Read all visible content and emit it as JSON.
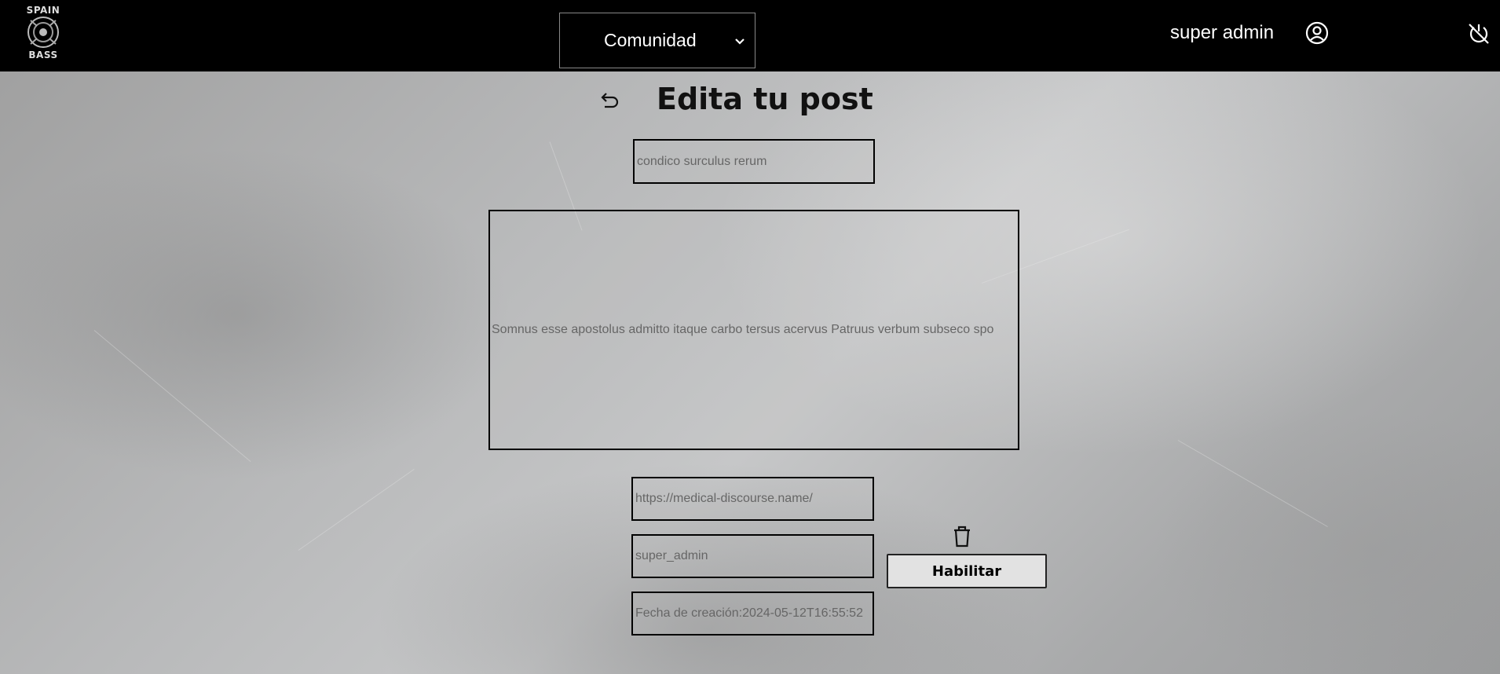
{
  "header": {
    "logo": {
      "top_text": "SPAIN",
      "bottom_text": "BASS"
    },
    "section_select": {
      "selected": "Comunidad",
      "icon": "chevron-down-icon"
    },
    "user": {
      "name": "super admin",
      "icon": "user-circle-icon"
    },
    "logout_icon": "power-off-icon"
  },
  "main": {
    "back_icon": "undo-arrow-icon",
    "title": "Edita tu post",
    "fields": {
      "title_value": "condico surculus rerum",
      "content_value": "Somnus esse apostolus admitto itaque carbo tersus acervus Patruus verbum subseco spo",
      "url_value": "https://medical-discourse.name/",
      "author_value": "super_admin",
      "date_value": "Fecha de creación:2024-05-12T16:55:52"
    },
    "delete_icon": "trash-icon",
    "enable_button": "Habilitar"
  },
  "colors": {
    "navbar": "#000000",
    "background": "#b3b4b5",
    "button_bg": "#e2e2e2"
  }
}
